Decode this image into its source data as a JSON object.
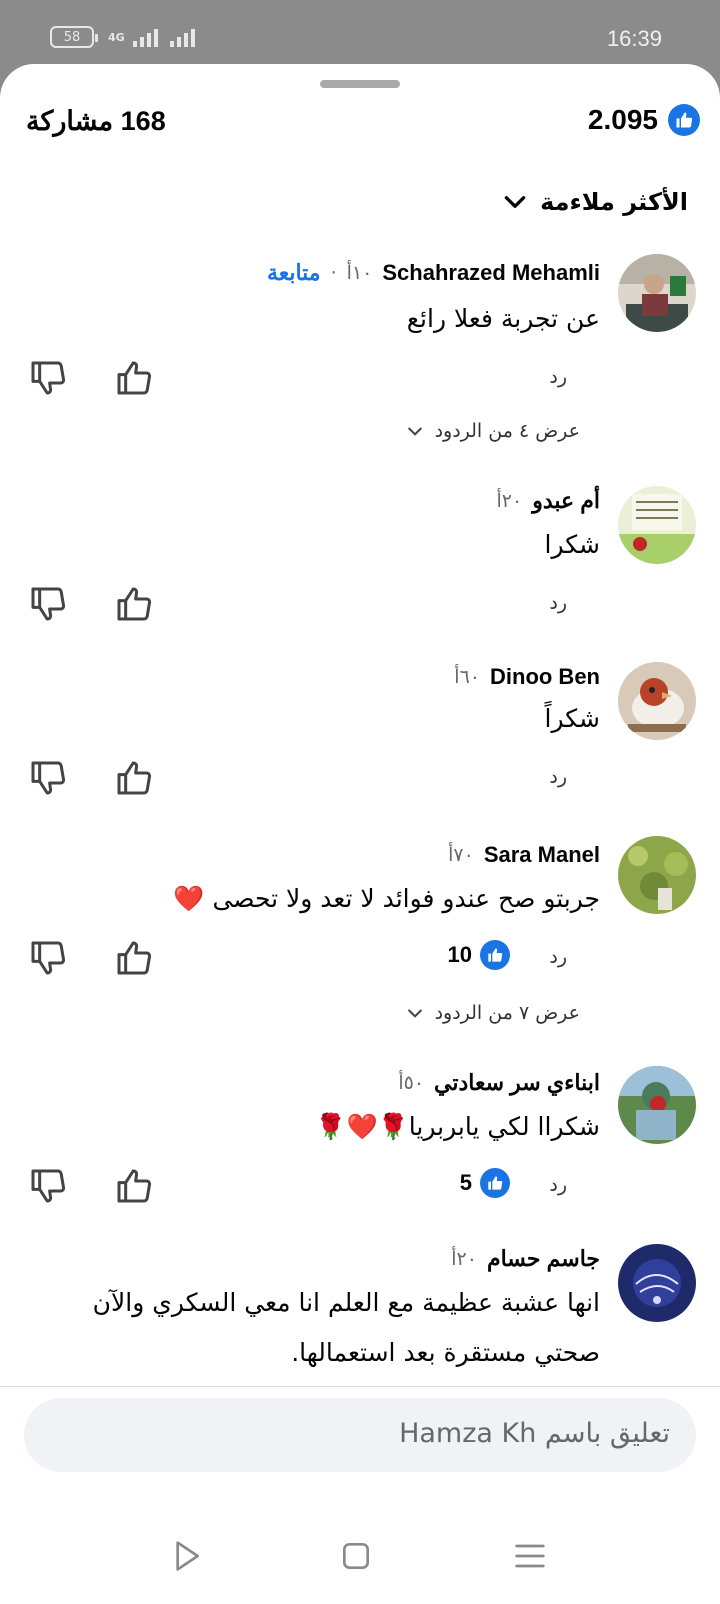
{
  "status_bar": {
    "battery": "58",
    "network": "4G",
    "time": "16:39"
  },
  "stats": {
    "likes": "2.095",
    "shares": "168 مشاركة"
  },
  "sort": {
    "label": "الأكثر ملاءمة"
  },
  "comments": [
    {
      "name": "Schahrazed Mehamli",
      "time": "١٠أ",
      "follow": "متابعة",
      "text": "عن تجربة فعلا رائع",
      "reply": "رد",
      "replies_label": "عرض ٤ من الردود",
      "avatar": "avatar-office"
    },
    {
      "name": "أم عبدو",
      "time": "٢٠أ",
      "text": "شكرا",
      "reply": "رد",
      "avatar": "avatar-card"
    },
    {
      "name": "Dinoo Ben",
      "time": "٦٠أ",
      "text": "شكراً",
      "reply": "رد",
      "avatar": "avatar-bird"
    },
    {
      "name": "Sara Manel",
      "time": "٧٠أ",
      "text": "جربتو صح عندو فوائد لا تعد ولا تحصى ❤️",
      "reply": "رد",
      "reactions": "10",
      "replies_label": "عرض ٧ من الردود",
      "avatar": "avatar-field"
    },
    {
      "name": "ابناءي سر سعادتي",
      "time": "٥٠أ",
      "text": "شكراا لكي يابربريا🌹❤️🌹",
      "reply": "رد",
      "reactions": "5",
      "avatar": "avatar-kid"
    },
    {
      "name": "جاسم حسام",
      "time": "٢٠أ",
      "text": "انها عشبة عظيمة مع العلم انا معي السكري والآن صحتي مستقرة بعد استعمالها.",
      "avatar": "avatar-calligraphy"
    }
  ],
  "composer": {
    "placeholder": "تعليق باسم Hamza Kh"
  },
  "nav": {
    "back": "back-icon",
    "home": "home-icon",
    "menu": "menu-icon"
  },
  "colors": {
    "accent": "#1b74e4",
    "muted": "#65676b",
    "background": "#ffffff"
  }
}
